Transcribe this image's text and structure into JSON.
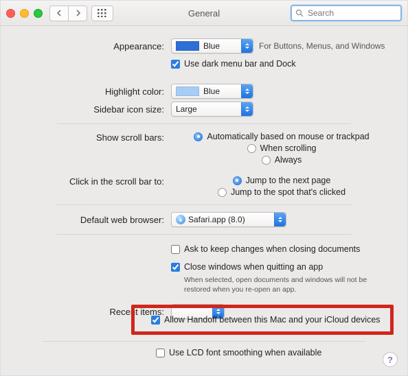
{
  "title": "General",
  "search_placeholder": "Search",
  "labels": {
    "appearance": "Appearance:",
    "highlight": "Highlight color:",
    "sidebar": "Sidebar icon size:",
    "scrollbars": "Show scroll bars:",
    "clickbar": "Click in the scroll bar to:",
    "browser": "Default web browser:",
    "recent": "Recent items:"
  },
  "appearance": {
    "value": "Blue",
    "swatch": "#2e6fd6",
    "hint": "For Buttons, Menus, and Windows",
    "darkmenu": "Use dark menu bar and Dock",
    "darkmenu_checked": true
  },
  "highlight": {
    "value": "Blue",
    "swatch": "#a7cdf5"
  },
  "sidebar": {
    "value": "Large"
  },
  "scrollbars": {
    "options": [
      "Automatically based on mouse or trackpad",
      "When scrolling",
      "Always"
    ],
    "selected": 0
  },
  "clickbar": {
    "options": [
      "Jump to the next page",
      "Jump to the spot that's clicked"
    ],
    "selected": 0
  },
  "browser": {
    "value": "Safari.app (8.0)"
  },
  "docs": {
    "ask": "Ask to keep changes when closing documents",
    "ask_checked": false,
    "close": "Close windows when quitting an app",
    "close_checked": true,
    "close_hint1": "When selected, open documents and windows will not be",
    "close_hint2": "restored when you re-open an app."
  },
  "handoff": {
    "label": "Allow Handoff between this Mac and your iCloud devices",
    "checked": true
  },
  "lcd": {
    "label": "Use LCD font smoothing when available",
    "checked": false
  }
}
